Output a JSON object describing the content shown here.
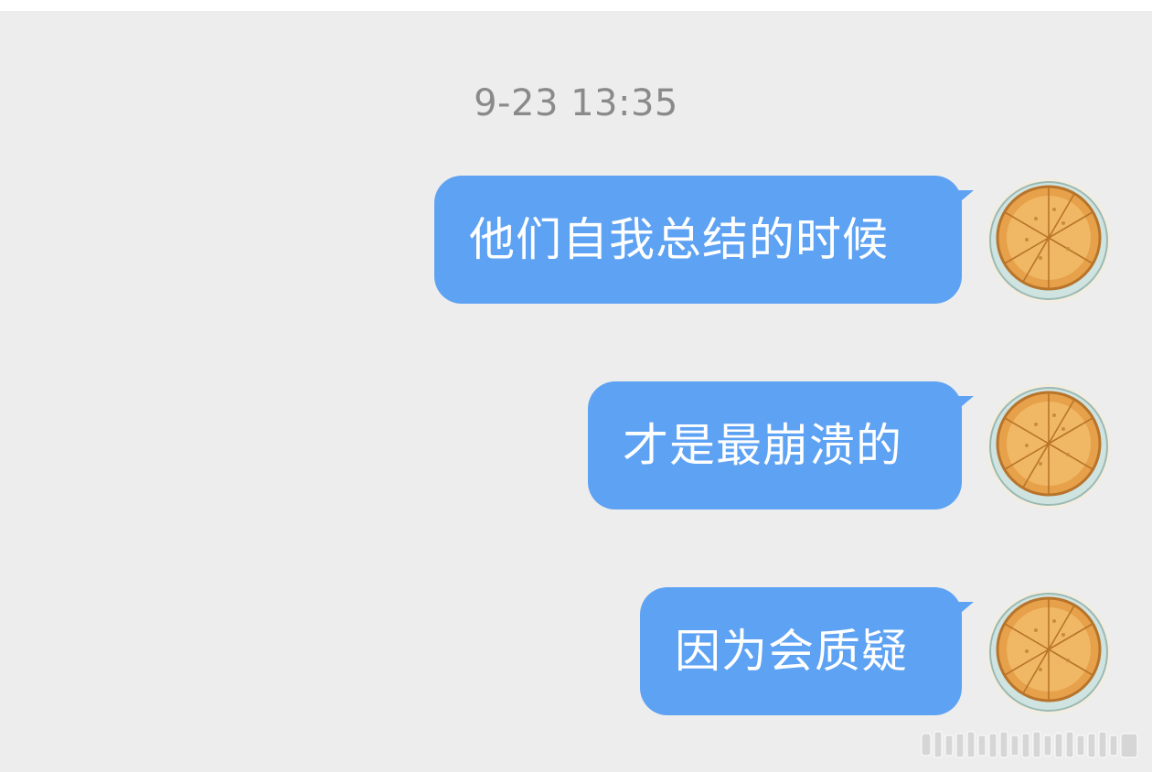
{
  "timestamp": "9-23 13:35",
  "messages": [
    {
      "text": "他们自我总结的时候",
      "sender": "self",
      "avatar_icon": "pizza-avatar-icon"
    },
    {
      "text": "才是最崩溃的",
      "sender": "self",
      "avatar_icon": "pizza-avatar-icon"
    },
    {
      "text": "因为会质疑",
      "sender": "self",
      "avatar_icon": "pizza-avatar-icon"
    }
  ],
  "colors": {
    "background": "#ededed",
    "bubble": "#5ea2f3",
    "bubble_text": "#ffffff",
    "timestamp": "#8a8a8a"
  }
}
